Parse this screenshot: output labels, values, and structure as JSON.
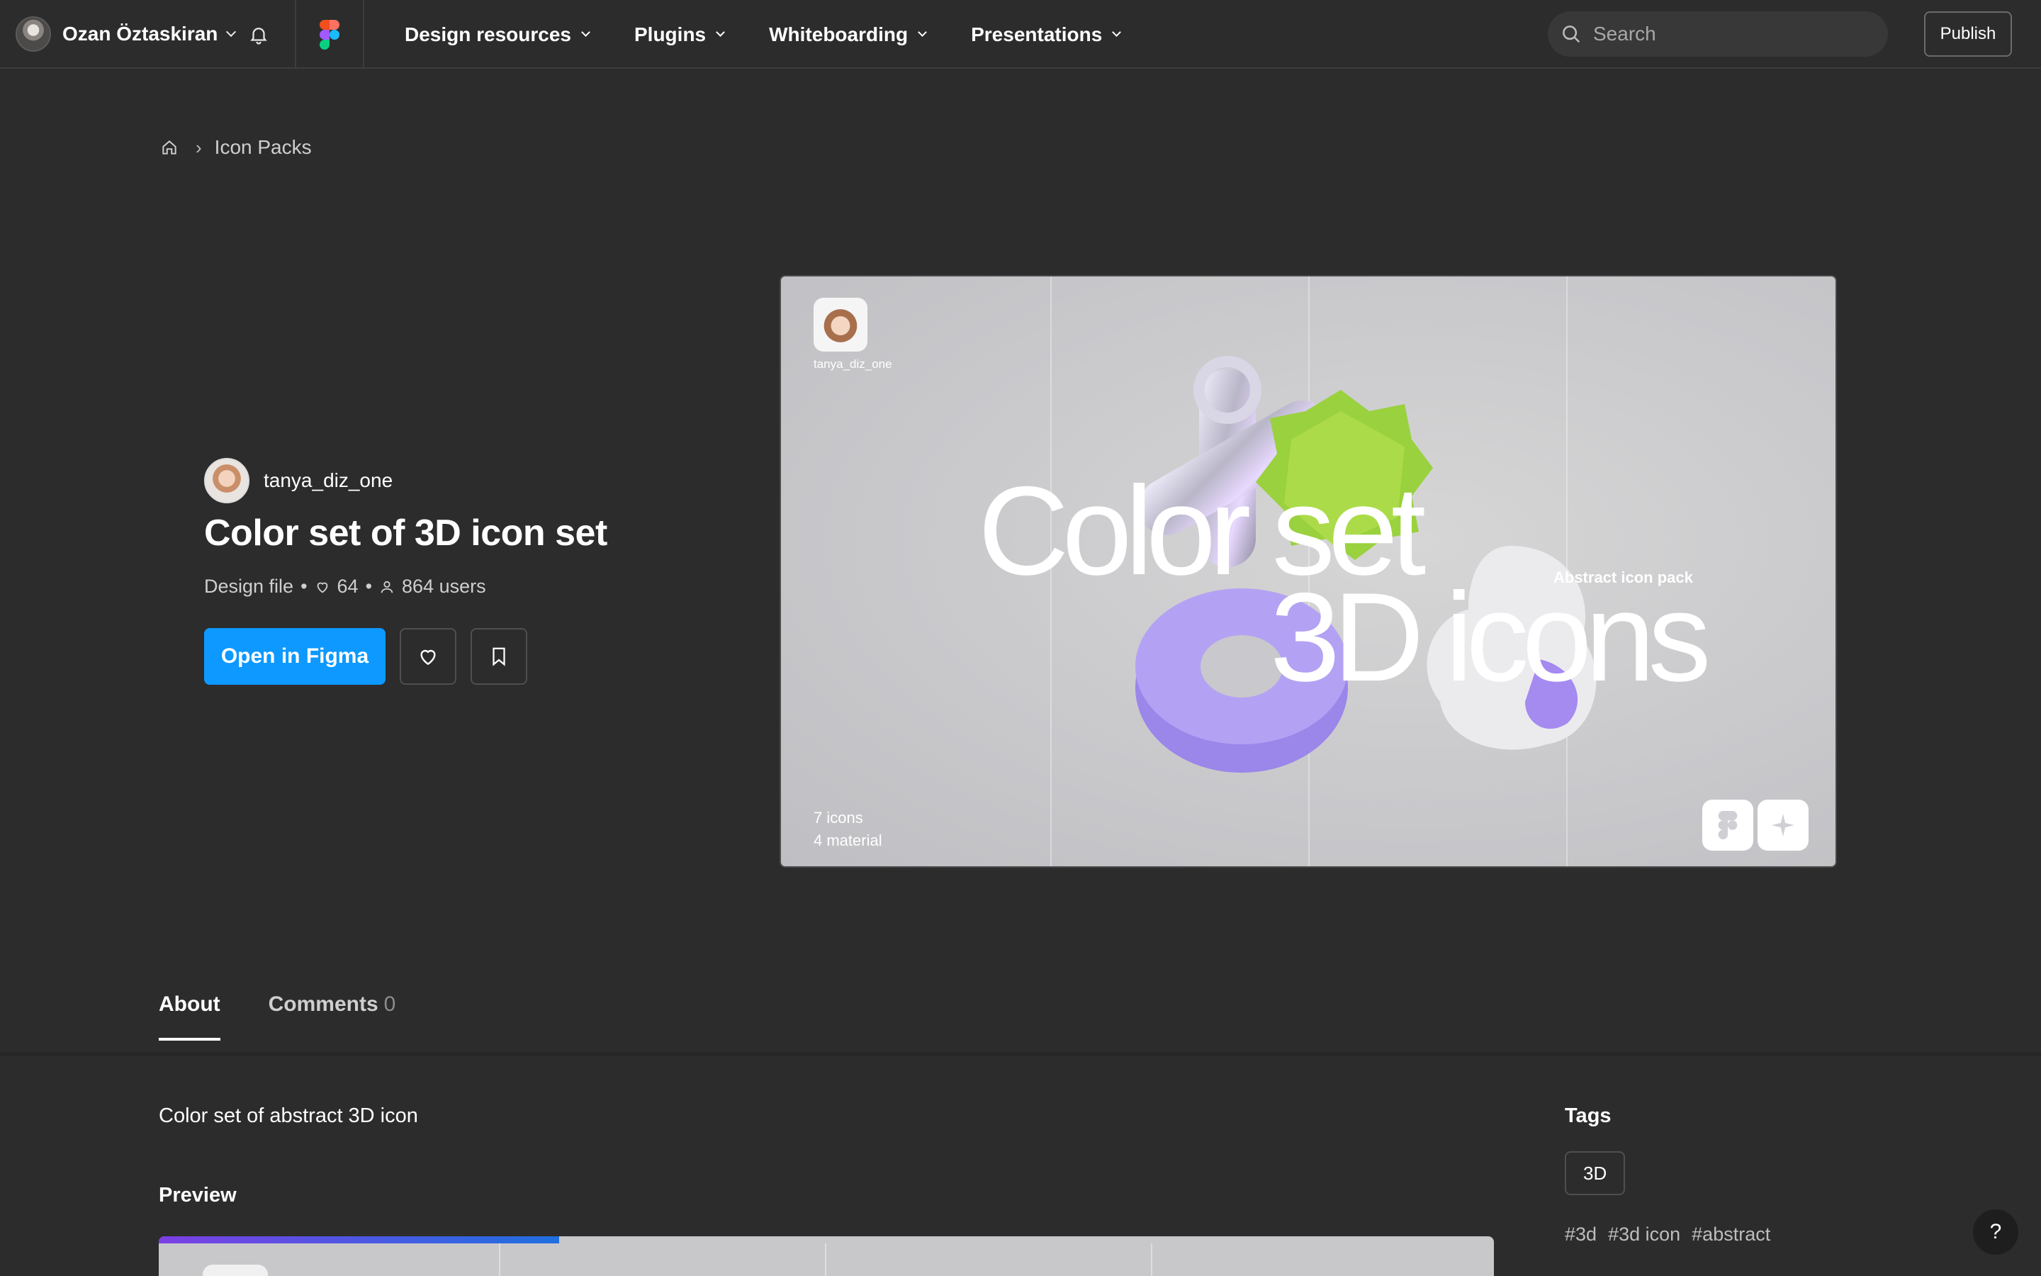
{
  "topbar": {
    "user_name": "Ozan Öztaskiran",
    "nav": [
      {
        "label": "Design resources"
      },
      {
        "label": "Plugins"
      },
      {
        "label": "Whiteboarding"
      },
      {
        "label": "Presentations"
      }
    ],
    "search_placeholder": "Search",
    "publish_label": "Publish"
  },
  "breadcrumb": {
    "current": "Icon Packs",
    "separator": "›"
  },
  "file": {
    "creator": "tanya_diz_one",
    "title": "Color set of 3D icon set",
    "type": "Design file",
    "likes": "64",
    "users": "864 users",
    "open_label": "Open in Figma"
  },
  "hero": {
    "creator": "tanya_diz_one",
    "line1": "Color set",
    "line2": "3D icons",
    "subtitle": "Abstract icon pack",
    "count_icons": "7 icons",
    "count_material": "4 material"
  },
  "tabs": [
    {
      "label": "About",
      "count": ""
    },
    {
      "label": "Comments",
      "count": "0"
    }
  ],
  "about": {
    "description": "Color set of abstract 3D icon",
    "preview_heading": "Preview",
    "preview_progress": 0.3
  },
  "tags": {
    "heading": "Tags",
    "chip": "3D",
    "hashtags": [
      "#3d",
      "#3d icon",
      "#abstract"
    ]
  },
  "help_label": "?",
  "colors": {
    "accent": "#0d99ff",
    "background": "#2c2c2c"
  }
}
